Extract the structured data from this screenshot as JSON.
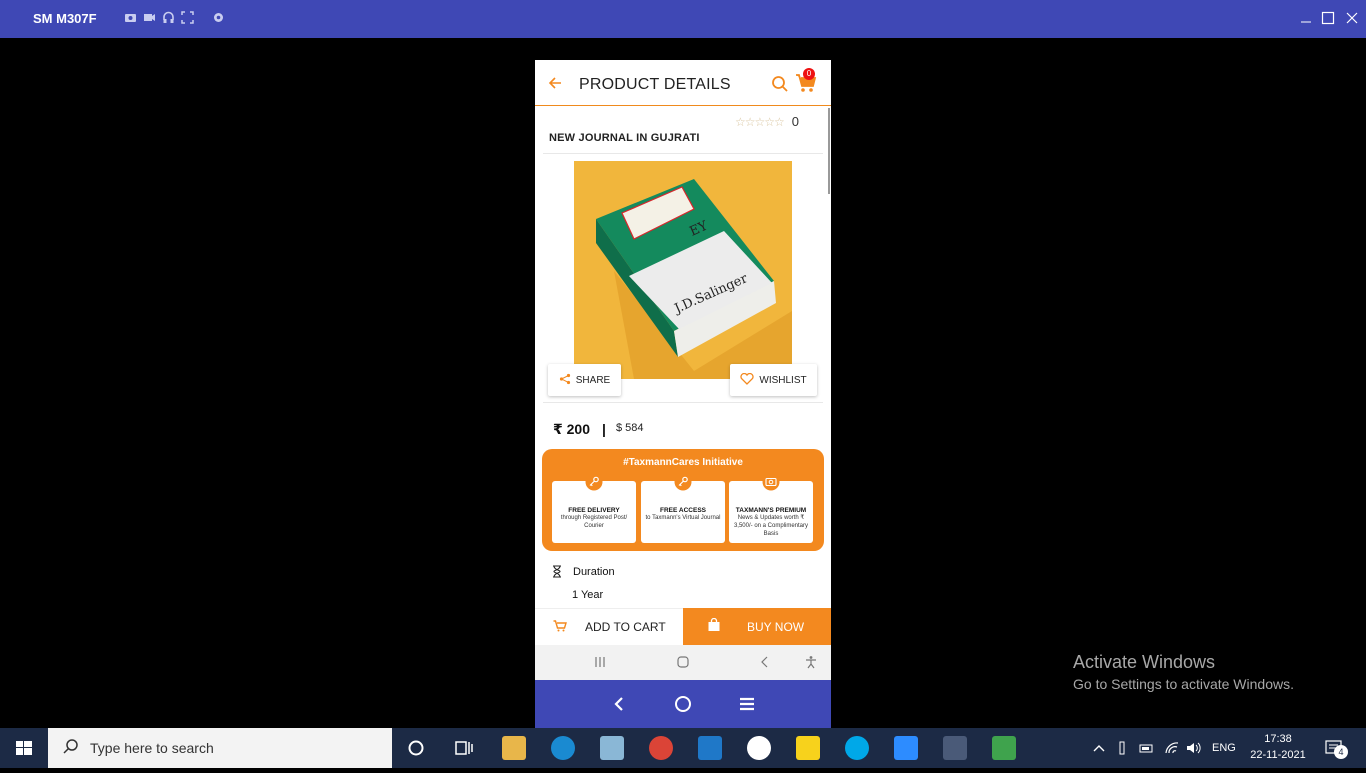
{
  "window": {
    "device_name": "SM M307F"
  },
  "app": {
    "header_title": "PRODUCT DETAILS",
    "cart_count": "0",
    "rating_count": "0",
    "product_name": "NEW JOURNAL IN GUJRATI",
    "book_cover_author": "J.D.Salinger",
    "book_cover_title_fragment": "EY",
    "share_label": "SHARE",
    "wishlist_label": "WISHLIST",
    "price_inr": "₹ 200",
    "price_separator": "|",
    "price_usd": "$ 584",
    "cares": {
      "title": "#TaxmannCares Initiative",
      "cards": [
        {
          "heading": "FREE DELIVERY",
          "sub": "through Registered Post/ Courier"
        },
        {
          "heading": "FREE ACCESS",
          "sub": "to Taxmann's Virtual Journal"
        },
        {
          "heading": "TAXMANN'S PREMIUM",
          "sub": "News & Updates worth ₹ 3,500/- on a Complimentary Basis"
        }
      ]
    },
    "duration_label": "Duration",
    "duration_value": "1 Year",
    "add_to_cart_label": "ADD TO CART",
    "buy_now_label": "BUY NOW",
    "accent_color": "#f3891f"
  },
  "activation": {
    "title": "Activate Windows",
    "subtitle": "Go to Settings to activate Windows."
  },
  "taskbar": {
    "search_placeholder": "Type here to search",
    "language": "ENG",
    "time": "17:38",
    "date": "22-11-2021",
    "notification_count": "4"
  }
}
